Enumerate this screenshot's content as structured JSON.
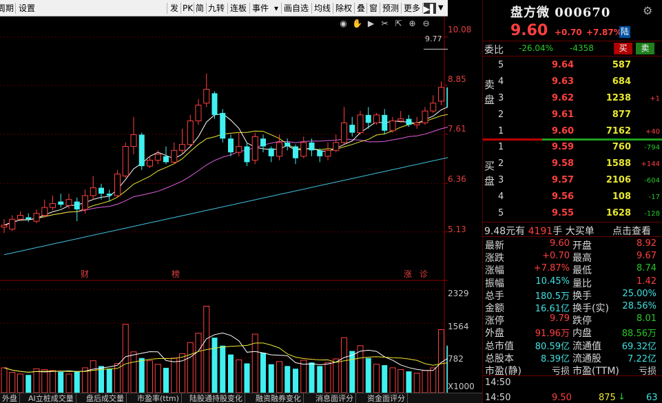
{
  "menu": {
    "items": [
      "周期",
      "设置",
      "发",
      "PK",
      "简",
      "九转",
      "连板",
      "事件",
      "▾",
      "画",
      "自选",
      "均线",
      "除权",
      "叠",
      "窗",
      "预测",
      "更多"
    ]
  },
  "chart": {
    "price_axis": [
      "10.08",
      "8.85",
      "7.61",
      "6.36",
      "5.13"
    ],
    "high_label": "9.77",
    "volume_axis": [
      "2329",
      "1564",
      "782"
    ],
    "volume_unit": "X1000",
    "events": [
      "财",
      "榜",
      "涨",
      "诊"
    ]
  },
  "tabs": [
    "外盘",
    "AI立桩成交量",
    "盘后成交量",
    "市盈率(ttm)",
    "陆股通持股变化",
    "融资融券变化",
    "消息面评分",
    "资金面评分"
  ],
  "quote": {
    "name": "盘方微",
    "code": "000670",
    "price": "9.60",
    "change": "+0.70",
    "change_pct": "+7.87%",
    "badge": "陆",
    "weibi_label": "委比",
    "weibi_pct": "-26.04%",
    "weibi_diff": "-4358",
    "sell_btn": "买",
    "buy_btn": "卖"
  },
  "asks": [
    {
      "level": "5",
      "price": "9.64",
      "vol": "587",
      "delta": ""
    },
    {
      "level": "4",
      "price": "9.63",
      "vol": "684",
      "delta": ""
    },
    {
      "level": "3",
      "price": "9.62",
      "vol": "1238",
      "delta": "+1"
    },
    {
      "level": "2",
      "price": "9.61",
      "vol": "877",
      "delta": ""
    },
    {
      "level": "1",
      "price": "9.60",
      "vol": "7162",
      "delta": "+40"
    }
  ],
  "bids": [
    {
      "level": "1",
      "price": "9.59",
      "vol": "760",
      "delta": "-794"
    },
    {
      "level": "2",
      "price": "9.58",
      "vol": "1588",
      "delta": "+144"
    },
    {
      "level": "3",
      "price": "9.57",
      "vol": "2106",
      "delta": "-604"
    },
    {
      "level": "4",
      "price": "9.56",
      "vol": "108",
      "delta": "-17"
    },
    {
      "level": "5",
      "price": "9.55",
      "vol": "1628",
      "delta": "-128"
    }
  ],
  "ask_side_label": [
    "卖",
    "盘"
  ],
  "bid_side_label": [
    "买",
    "盘"
  ],
  "bigorder": {
    "price": "9.48",
    "unit1": "元有",
    "vol": "4191",
    "unit2": "手",
    "label": "大买单",
    "link": "点击查看"
  },
  "stats": [
    {
      "l1": "最新",
      "v1": "9.60",
      "c1": "red",
      "l2": "开盘",
      "v2": "8.92",
      "c2": "red"
    },
    {
      "l1": "涨跌",
      "v1": "+0.70",
      "c1": "red",
      "l2": "最高",
      "v2": "9.67",
      "c2": "red"
    },
    {
      "l1": "涨幅",
      "v1": "+7.87%",
      "c1": "red",
      "l2": "最低",
      "v2": "8.74",
      "c2": "green"
    },
    {
      "l1": "振幅",
      "v1": "10.45%",
      "c1": "cyan",
      "l2": "量比",
      "v2": "1.42",
      "c2": "red"
    },
    {
      "l1": "总手",
      "v1": "180.5万",
      "c1": "cyan",
      "l2": "换手",
      "v2": "25.00%",
      "c2": "cyan"
    },
    {
      "l1": "金额",
      "v1": "16.61亿",
      "c1": "cyan",
      "l2": "换手(实)",
      "v2": "28.56%",
      "c2": "cyan"
    },
    {
      "l1": "涨停",
      "v1": "9.79",
      "c1": "red",
      "l2": "跌停",
      "v2": "8.01",
      "c2": "green"
    },
    {
      "l1": "外盘",
      "v1": "91.96万",
      "c1": "red",
      "l2": "内盘",
      "v2": "88.56万",
      "c2": "green"
    },
    {
      "l1": "总市值",
      "v1": "80.59亿",
      "c1": "cyan",
      "l2": "流通值",
      "v2": "69.32亿",
      "c2": "cyan"
    },
    {
      "l1": "总股本",
      "v1": "8.39亿",
      "c1": "cyan",
      "l2": "流通股",
      "v2": "7.22亿",
      "c2": "cyan"
    },
    {
      "l1": "市盈(静)",
      "v1": "亏损",
      "c1": "white",
      "l2": "市盈(TTM)",
      "v2": "亏损",
      "c2": "white"
    }
  ],
  "ticks": [
    {
      "time": "14:50",
      "price": "",
      "vol": ""
    },
    {
      "time": "14:50",
      "price": "9.50",
      "vol": "875",
      "dir": "↓",
      "n": "63"
    }
  ],
  "colors": {
    "up": "#ff4040",
    "down": "#40f0f0",
    "ma5": "#ffffff",
    "ma10": "#e8e830",
    "ma20": "#e060e0",
    "ma60": "#40c0e0"
  },
  "chart_data": {
    "type": "candlestick",
    "price_ylim": [
      4.3,
      10.6
    ],
    "volume_ylim": [
      0,
      2500
    ],
    "candles": [
      [
        5.25,
        5.3,
        5.1,
        5.45
      ],
      [
        5.2,
        5.45,
        5.15,
        5.55
      ],
      [
        5.45,
        5.55,
        5.4,
        5.65
      ],
      [
        5.5,
        5.45,
        5.38,
        5.6
      ],
      [
        5.4,
        5.6,
        5.35,
        5.7
      ],
      [
        5.55,
        5.75,
        5.5,
        5.95
      ],
      [
        5.75,
        5.85,
        5.68,
        6.05
      ],
      [
        5.9,
        5.82,
        5.75,
        6.1
      ],
      [
        5.8,
        5.95,
        5.72,
        6.1
      ],
      [
        5.9,
        5.7,
        5.4,
        6.0
      ],
      [
        5.7,
        6.05,
        5.6,
        6.2
      ],
      [
        6.05,
        6.25,
        5.95,
        6.55
      ],
      [
        6.25,
        6.1,
        5.95,
        6.35
      ],
      [
        6.1,
        6.05,
        5.9,
        6.2
      ],
      [
        6.05,
        6.6,
        6.0,
        6.7
      ],
      [
        6.55,
        7.3,
        6.5,
        7.4
      ],
      [
        7.3,
        7.6,
        7.1,
        8.05
      ],
      [
        7.6,
        6.8,
        6.7,
        7.65
      ],
      [
        6.8,
        6.95,
        6.75,
        7.05
      ],
      [
        6.95,
        7.1,
        6.85,
        7.2
      ],
      [
        7.05,
        6.9,
        6.85,
        7.3
      ],
      [
        6.9,
        7.2,
        6.85,
        7.4
      ],
      [
        7.2,
        7.35,
        7.1,
        7.75
      ],
      [
        7.35,
        7.95,
        7.3,
        8.1
      ],
      [
        7.95,
        8.35,
        7.85,
        8.5
      ],
      [
        8.4,
        8.75,
        8.3,
        9.15
      ],
      [
        8.65,
        8.1,
        8.0,
        8.7
      ],
      [
        8.15,
        7.5,
        7.4,
        8.25
      ],
      [
        7.5,
        7.15,
        7.05,
        7.6
      ],
      [
        7.15,
        7.3,
        7.05,
        7.65
      ],
      [
        7.3,
        6.9,
        6.8,
        7.4
      ],
      [
        6.95,
        7.55,
        6.85,
        7.65
      ],
      [
        7.5,
        7.3,
        7.15,
        7.6
      ],
      [
        7.25,
        7.05,
        6.9,
        7.3
      ],
      [
        7.05,
        7.4,
        6.95,
        7.6
      ],
      [
        7.4,
        7.3,
        7.2,
        7.5
      ],
      [
        7.3,
        7.0,
        6.85,
        7.35
      ],
      [
        7.05,
        7.4,
        7.0,
        7.55
      ],
      [
        7.4,
        7.2,
        7.05,
        7.5
      ],
      [
        7.2,
        7.05,
        6.9,
        7.25
      ],
      [
        7.05,
        7.2,
        6.95,
        7.4
      ],
      [
        7.2,
        7.4,
        7.15,
        7.6
      ],
      [
        7.4,
        7.9,
        7.35,
        8.3
      ],
      [
        7.85,
        7.65,
        7.55,
        8.05
      ],
      [
        7.65,
        8.1,
        7.6,
        8.2
      ],
      [
        8.1,
        7.9,
        7.75,
        8.3
      ],
      [
        7.9,
        8.1,
        7.85,
        8.15
      ],
      [
        8.1,
        7.7,
        7.6,
        8.25
      ],
      [
        7.7,
        7.95,
        7.65,
        8.05
      ],
      [
        7.95,
        8.0,
        7.9,
        8.2
      ],
      [
        8.0,
        7.85,
        7.8,
        8.1
      ],
      [
        7.85,
        7.9,
        7.75,
        8.05
      ],
      [
        7.9,
        8.2,
        7.85,
        8.3
      ],
      [
        8.2,
        8.4,
        8.15,
        8.6
      ],
      [
        8.45,
        8.8,
        8.35,
        8.95
      ],
      [
        8.8,
        8.3,
        8.2,
        9.1
      ],
      [
        8.3,
        8.5,
        8.2,
        8.7
      ],
      [
        8.5,
        9.0,
        8.4,
        9.3
      ],
      [
        9.0,
        8.6,
        8.5,
        9.1
      ],
      [
        8.6,
        8.2,
        8.05,
        8.8
      ],
      [
        8.2,
        8.8,
        8.1,
        8.95
      ],
      [
        8.8,
        8.9,
        8.7,
        9.1
      ],
      [
        8.9,
        9.6,
        8.8,
        9.7
      ],
      [
        8.9,
        9.6,
        8.74,
        9.67
      ]
    ],
    "ma_series": [
      "MA5",
      "MA10",
      "MA20",
      "MA60"
    ],
    "volumes": [
      560,
      460,
      420,
      400,
      540,
      520,
      500,
      470,
      420,
      480,
      560,
      720,
      600,
      540,
      660,
      1540,
      920,
      780,
      720,
      640,
      560,
      780,
      880,
      1130,
      1340,
      1950,
      1240,
      1060,
      860,
      740,
      660,
      1320,
      900,
      640,
      700,
      600,
      540,
      730,
      680,
      600,
      680,
      760,
      1240,
      940,
      1060,
      780,
      640,
      620,
      560,
      520,
      480,
      440,
      500,
      560,
      1420,
      1060,
      940,
      900,
      980,
      1440,
      1100,
      900,
      2260,
      1800
    ]
  }
}
